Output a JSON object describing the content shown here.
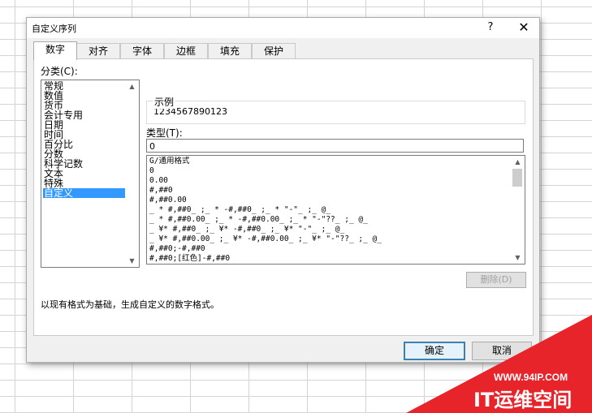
{
  "dialog": {
    "title": "自定义序列",
    "help": "?",
    "close": "✕"
  },
  "tabs": [
    "数字",
    "对齐",
    "字体",
    "边框",
    "填充",
    "保护"
  ],
  "active_tab": 0,
  "category": {
    "label": "分类(C):",
    "items": [
      "常规",
      "数值",
      "货币",
      "会计专用",
      "日期",
      "时间",
      "百分比",
      "分数",
      "科学记数",
      "文本",
      "特殊",
      "自定义"
    ],
    "selected": 11
  },
  "sample": {
    "label": "示例",
    "value": "1234567890123"
  },
  "type": {
    "label": "类型(T):",
    "value": "0"
  },
  "formats": [
    "G/通用格式",
    "0",
    "0.00",
    "#,##0",
    "#,##0.00",
    "_ * #,##0_ ;_ * -#,##0_ ;_ * \"-\"_ ;_ @_",
    "_ * #,##0.00_ ;_ * -#,##0.00_ ;_ * \"-\"??_ ;_ @_",
    "_ ¥* #,##0_ ;_ ¥* -#,##0_ ;_ ¥* \"-\"_ ;_ @_",
    "_ ¥* #,##0.00_ ;_ ¥* -#,##0.00_ ;_ ¥* \"-\"??_ ;_ @_",
    "#,##0;-#,##0",
    "#,##0;[红色]-#,##0"
  ],
  "delete_label": "删除(D)",
  "description": "以现有格式为基础，生成自定义的数字格式。",
  "ok_label": "确定",
  "cancel_label": "取消",
  "watermark": {
    "url": "WWW.94IP.COM",
    "brand": "IT运维空间",
    "color": "#e8242b"
  }
}
